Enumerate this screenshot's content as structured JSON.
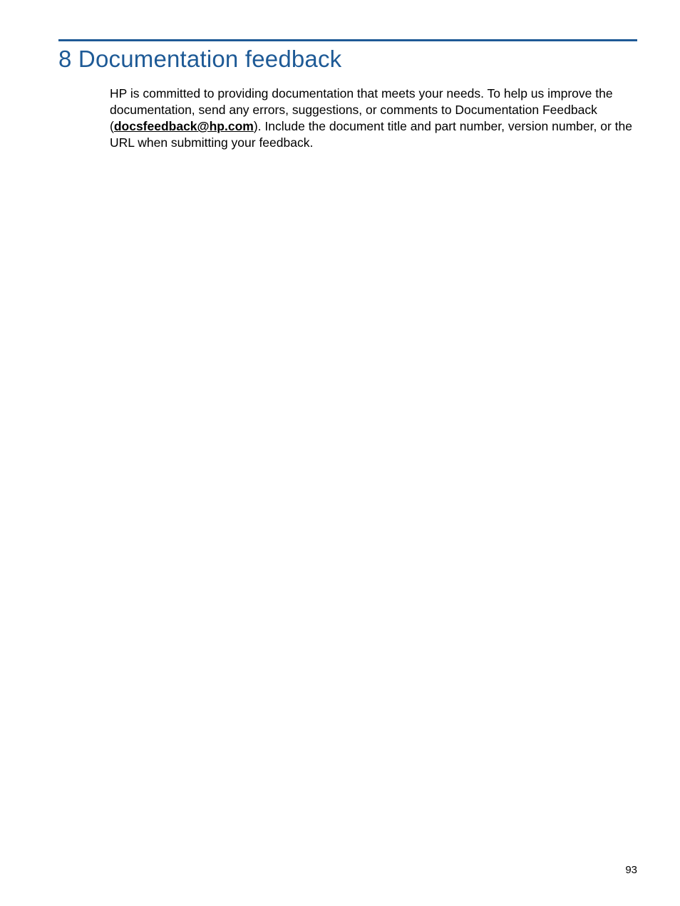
{
  "heading": "8 Documentation feedback",
  "body": {
    "part1": "HP is committed to providing documentation that meets your needs. To help us improve the documentation, send any errors, suggestions, or comments to Documentation Feedback (",
    "email": "docsfeedback@hp.com",
    "part2": "). Include the document title and part number, version number, or the URL when submitting your feedback."
  },
  "page_number": "93",
  "colors": {
    "accent": "#1e5a96"
  }
}
